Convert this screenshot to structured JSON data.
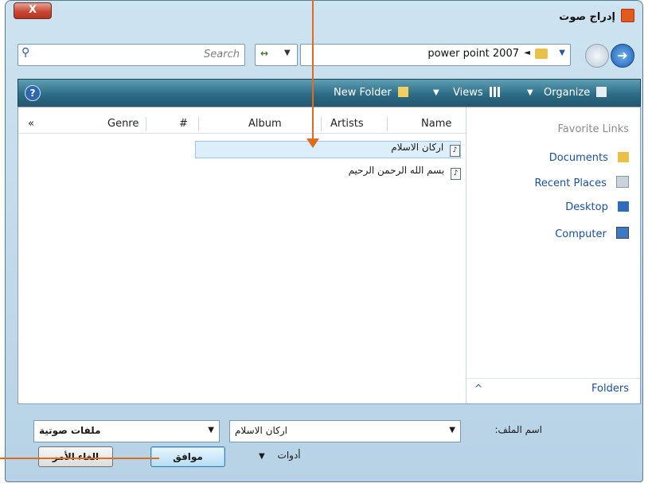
{
  "window": {
    "title": "إدراج صوت",
    "close_label": "X"
  },
  "toolbar": {
    "search_placeholder": "Search",
    "address": "power point 2007",
    "address_sep": "◄",
    "dropdown": "▼",
    "forward_label": "➜"
  },
  "commands": {
    "help": "?",
    "new_folder": "New Folder",
    "views": "Views",
    "organize": "Organize",
    "arrow": "▼"
  },
  "columns": {
    "collapse": "«",
    "genre": "Genre",
    "number": "#",
    "album": "Album",
    "artists": "Artists",
    "name": "Name"
  },
  "files": [
    {
      "name": "اركان الاسلام",
      "selected": true
    },
    {
      "name": "بسم الله الرحمن الرحيم",
      "selected": false
    }
  ],
  "favorites": {
    "title": "Favorite Links",
    "items": [
      "Documents",
      "Recent Places",
      "Desktop",
      "Computer"
    ],
    "folders_label": "Folders",
    "collapse": "^"
  },
  "bottom": {
    "filename_label": "اسم الملف:",
    "filename_value": "اركان الاسلام",
    "filetype_value": "ملفات صوتية",
    "tools_label": "أدوات",
    "ok_label": "موافق",
    "cancel_label": "الغاء الأمر"
  },
  "colors": {
    "accent": "#2d6c86",
    "annotation": "#e06b1f"
  }
}
